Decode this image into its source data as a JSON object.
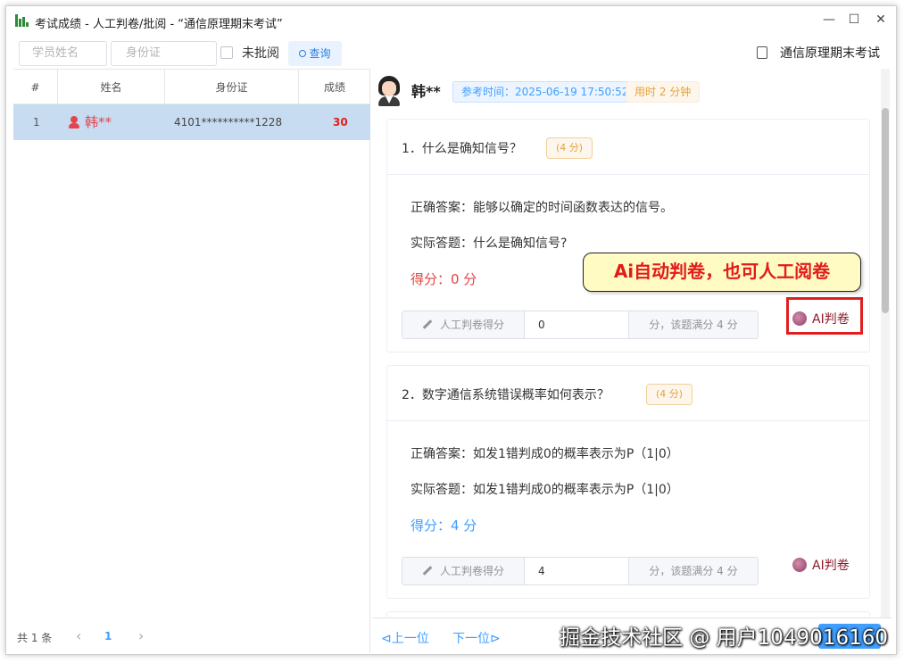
{
  "window": {
    "title": "考试成绩 - 人工判卷/批阅 - “通信原理期末考试”",
    "controls": [
      "—",
      "☐",
      "✕"
    ]
  },
  "toolbar": {
    "name_placeholder": "学员姓名",
    "id_placeholder": "身份证",
    "unreviewed_label": "未批阅",
    "query_label": "查询",
    "exam_name": "通信原理期末考试"
  },
  "grid": {
    "columns": [
      "#",
      "姓名",
      "身份证",
      "成绩"
    ],
    "rows": [
      {
        "index": "1",
        "name": "韩**",
        "id_card": "4101**********1228",
        "score": "30"
      }
    ]
  },
  "pager": {
    "total": "共 1 条",
    "prev": "‹",
    "page": "1",
    "next": "›"
  },
  "student": {
    "name": "韩**",
    "exam_time": "参考时间：2025-06-19 17:50:52",
    "duration": "用时 2 分钟"
  },
  "questions": [
    {
      "title": "1．什么是确知信号？",
      "score_tag": "(4 分)",
      "correct_answer": "正确答案：能够以确定的时间函数表达的信号。",
      "actual_answer": "实际答题：什么是确知信号?",
      "score": "得分：0 分",
      "manual_label": "人工判卷得分",
      "manual_value": "0",
      "manual_suffix": "分，该题满分 4 分",
      "ai_label": "AI判卷"
    },
    {
      "title": "2．数字通信系统错误概率如何表示？",
      "score_tag": "(4 分)",
      "correct_answer": "正确答案：如发1错判成0的概率表示为P（1|0）",
      "actual_answer": "实际答题：如发1错判成0的概率表示为P（1|0）",
      "score": "得分：4 分",
      "manual_label": "人工判卷得分",
      "manual_value": "4",
      "manual_suffix": "分，该题满分 4 分",
      "ai_label": "AI判卷"
    }
  ],
  "callout": "Ai自动判卷，也可人工阅卷",
  "footer": {
    "prev": "⊲上一位",
    "next": "下一位⊳"
  },
  "watermark": "掘金技术社区 @ 用户1049016160",
  "colors": {
    "accent": "#409eff",
    "selected_row": "#c7dcf1",
    "score_red": "#e64242",
    "highlight": "#e02020"
  }
}
